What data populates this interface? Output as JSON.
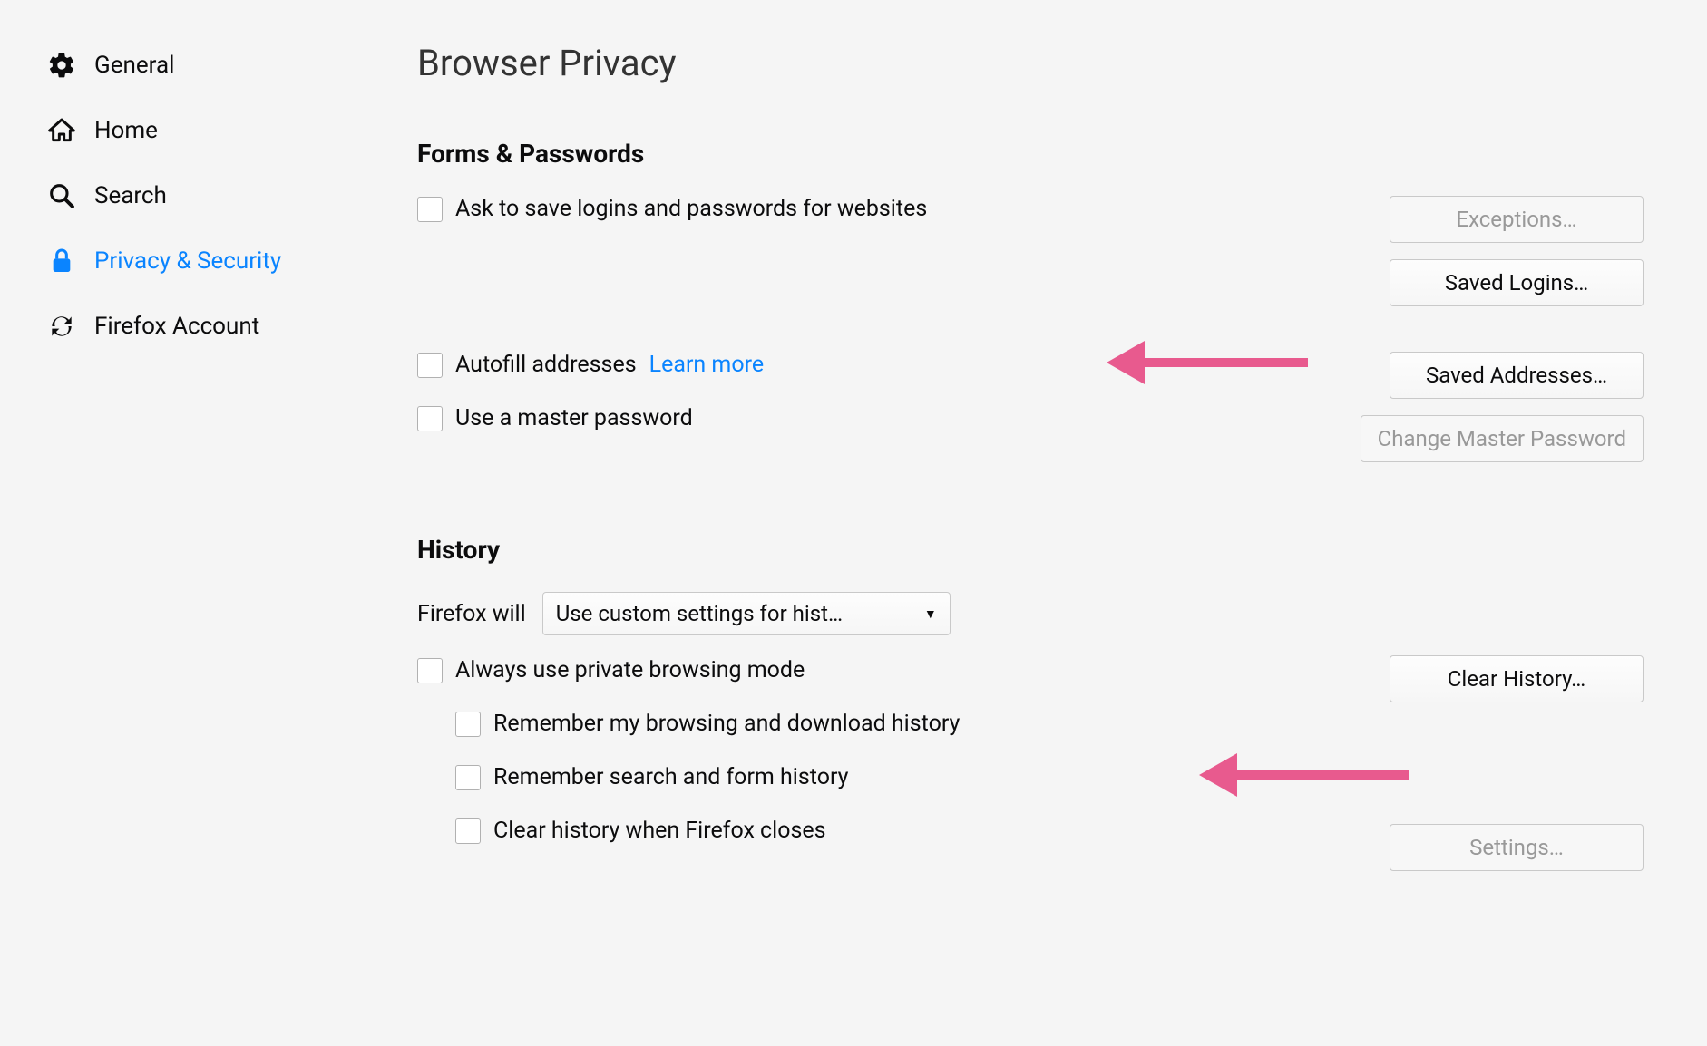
{
  "sidebar": {
    "items": [
      {
        "label": "General",
        "icon": "gear-icon",
        "active": false
      },
      {
        "label": "Home",
        "icon": "home-icon",
        "active": false
      },
      {
        "label": "Search",
        "icon": "search-icon",
        "active": false
      },
      {
        "label": "Privacy & Security",
        "icon": "lock-icon",
        "active": true
      },
      {
        "label": "Firefox Account",
        "icon": "sync-icon",
        "active": false
      }
    ]
  },
  "main": {
    "page_title": "Browser Privacy",
    "forms_section": {
      "title": "Forms & Passwords",
      "ask_save_logins_label": "Ask to save logins and passwords for websites",
      "exceptions_button": "Exceptions…",
      "saved_logins_button": "Saved Logins…",
      "autofill_addresses_label": "Autofill addresses",
      "learn_more_link": "Learn more",
      "saved_addresses_button": "Saved Addresses…",
      "master_password_label": "Use a master password",
      "change_master_password_button": "Change Master Password"
    },
    "history_section": {
      "title": "History",
      "firefox_will_label": "Firefox will",
      "dropdown_value": "Use custom settings for hist…",
      "private_browsing_label": "Always use private browsing mode",
      "remember_browsing_label": "Remember my browsing and download history",
      "remember_search_label": "Remember search and form history",
      "clear_on_close_label": "Clear history when Firefox closes",
      "clear_history_button": "Clear History…",
      "settings_button": "Settings…"
    }
  }
}
